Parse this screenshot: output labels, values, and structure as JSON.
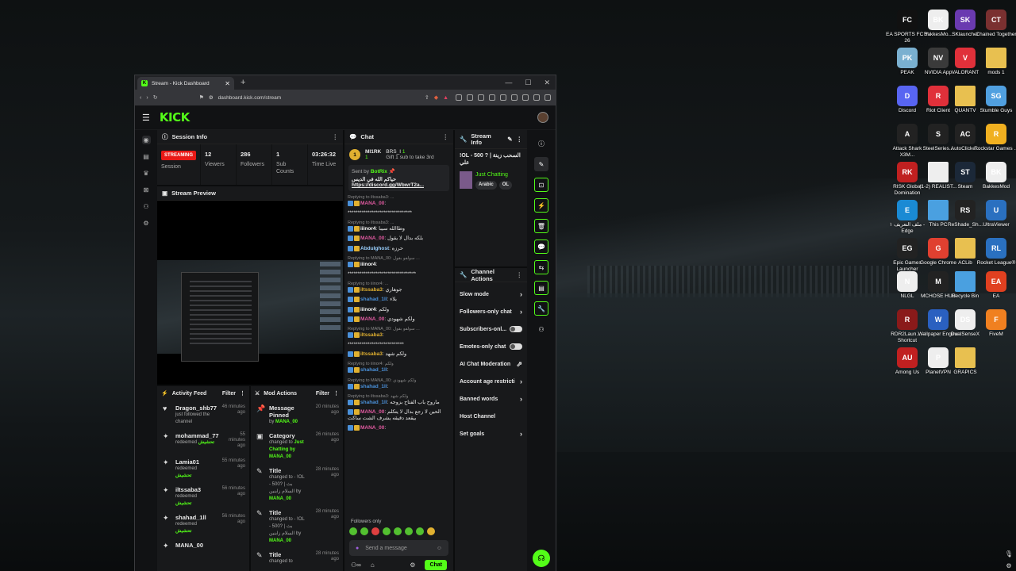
{
  "desktop": {
    "icons": [
      {
        "label": "EA SPORTS FC™ 26",
        "color": "#111",
        "glyph": "FC"
      },
      {
        "label": "BakkesMo...",
        "color": "#eee",
        "glyph": "BK"
      },
      {
        "label": "SKlauncher",
        "color": "#6a3ab0",
        "glyph": "SK"
      },
      {
        "label": "Chained Together",
        "color": "#7a3030",
        "glyph": "CT"
      },
      {
        "label": "PEAK",
        "color": "#7ab0d0",
        "glyph": "PK"
      },
      {
        "label": "NVIDIA App",
        "color": "#3a3a3a",
        "glyph": "NV"
      },
      {
        "label": "VALORANT",
        "color": "#e0303a",
        "glyph": "V"
      },
      {
        "label": "mods 1",
        "color": "#e8c050",
        "glyph": ""
      },
      {
        "label": "Discord",
        "color": "#5865f2",
        "glyph": "D"
      },
      {
        "label": "Riot Client",
        "color": "#e0303a",
        "glyph": "R"
      },
      {
        "label": "QUANTV",
        "color": "#e8c050",
        "glyph": ""
      },
      {
        "label": "Stumble Guys",
        "color": "#50a0e0",
        "glyph": "SG"
      },
      {
        "label": "Attack Shark X3M...",
        "color": "#222",
        "glyph": "A"
      },
      {
        "label": "SteelSeries...",
        "color": "#222",
        "glyph": "S"
      },
      {
        "label": "AutoClicke...",
        "color": "#222",
        "glyph": "AC"
      },
      {
        "label": "Rockstar Games ...",
        "color": "#f0b020",
        "glyph": "R"
      },
      {
        "label": "RISK Global Domination",
        "color": "#c02020",
        "glyph": "RK"
      },
      {
        "label": "(1-2) REALIST...",
        "color": "#eee",
        "glyph": ""
      },
      {
        "label": "Steam",
        "color": "#1b2838",
        "glyph": "ST"
      },
      {
        "label": "BakkesMod",
        "color": "#eee",
        "glyph": "BK"
      },
      {
        "label": "ملف التعريف ١ - Edge",
        "color": "#1a8ad4",
        "glyph": "E"
      },
      {
        "label": "This PC",
        "color": "#4aa0e0",
        "glyph": ""
      },
      {
        "label": "ReShade_Sh...",
        "color": "#222",
        "glyph": "RS"
      },
      {
        "label": "UltraViewer",
        "color": "#2a70c0",
        "glyph": "U"
      },
      {
        "label": "Epic Games Launcher",
        "color": "#222",
        "glyph": "EG"
      },
      {
        "label": "Google Chrome",
        "color": "#e04030",
        "glyph": "G"
      },
      {
        "label": "ACLib",
        "color": "#e8c050",
        "glyph": ""
      },
      {
        "label": "Rocket League®",
        "color": "#2a70c0",
        "glyph": "RL"
      },
      {
        "label": "NLGL",
        "color": "#eee",
        "glyph": "N"
      },
      {
        "label": "MCHOSE HUB",
        "color": "#222",
        "glyph": "M"
      },
      {
        "label": "Recycle Bin",
        "color": "#4aa0e0",
        "glyph": ""
      },
      {
        "label": "EA",
        "color": "#e04020",
        "glyph": "EA"
      },
      {
        "label": "RDR2Laun... - Shortcut",
        "color": "#8a1a1a",
        "glyph": "R"
      },
      {
        "label": "Wallpaper Engine",
        "color": "#2a60c0",
        "glyph": "W"
      },
      {
        "label": "DualSenseX",
        "color": "#eee",
        "glyph": "DS"
      },
      {
        "label": "FiveM",
        "color": "#f08020",
        "glyph": "F"
      },
      {
        "label": "Among Us",
        "color": "#c02020",
        "glyph": "AU"
      },
      {
        "label": "PlanetVPN",
        "color": "#eee",
        "glyph": "P"
      },
      {
        "label": "GRAPICS",
        "color": "#e8c050",
        "glyph": ""
      }
    ]
  },
  "browser": {
    "tab_title": "Stream - Kick Dashboard",
    "url": "dashboard.kick.com/stream"
  },
  "kick": {
    "logo": "KICK",
    "session": {
      "title": "Session Info",
      "status": "STREAMING",
      "status_label": "Session",
      "stats": [
        {
          "value": "12",
          "label": "Viewers"
        },
        {
          "value": "286",
          "label": "Followers"
        },
        {
          "value": "1",
          "label": "Sub Counts"
        },
        {
          "value": "03:26:32",
          "label": "Time Live"
        }
      ]
    },
    "preview": {
      "title": "Stream Preview"
    },
    "activity": {
      "title": "Activity Feed",
      "filter": "Filter",
      "items": [
        {
          "name": "Dragon_shb77",
          "sub": "just followed the channel",
          "extra": "",
          "time": "46 minutes ago",
          "icon": "♥"
        },
        {
          "name": "mohammad_77",
          "sub": "redeemed",
          "extra": "تحشيش",
          "time": "55 minutes ago",
          "icon": "✦"
        },
        {
          "name": "Lamia01",
          "sub": "redeemed",
          "extra": "تحشيش",
          "time": "55 minutes ago",
          "icon": "✦"
        },
        {
          "name": "iltssaba3",
          "sub": "redeemed",
          "extra": "تحشيش",
          "time": "56 minutes ago",
          "icon": "✦"
        },
        {
          "name": "shahad_1ll",
          "sub": "redeemed",
          "extra": "تحشيش",
          "time": "56 minutes ago",
          "icon": "✦"
        },
        {
          "name": "MANA_00",
          "sub": "",
          "extra": "",
          "time": "",
          "icon": "✦"
        }
      ]
    },
    "mod": {
      "title": "Mod Actions",
      "filter": "Filter",
      "items": [
        {
          "name": "Message Pinned",
          "sub": "by",
          "extra": "MANA_00",
          "time": "20 minutes ago",
          "icon": "📌"
        },
        {
          "name": "Category",
          "sub": "changed to",
          "extra": "Just Chatting by MANA_00",
          "time": "26 minutes ago",
          "icon": "▣"
        },
        {
          "name": "Title",
          "sub": "changed to - !OL - 500? | بث السلام زاينين by",
          "extra": "MANA_00",
          "time": "28 minutes ago",
          "icon": "✎"
        },
        {
          "name": "Title",
          "sub": "changed to - !OL - 500? | بث السلام زاينين by",
          "extra": "MANA_00",
          "time": "28 minutes ago",
          "icon": "✎"
        },
        {
          "name": "Title",
          "sub": "changed to",
          "extra": "",
          "time": "28 minutes ago",
          "icon": "✎"
        }
      ]
    },
    "chat": {
      "title": "Chat",
      "gifter": "MI1RK",
      "gifter_count": "1",
      "gift_user": "BRS_I",
      "gift_count": "1",
      "gift_text": "Gift 1 sub to take 3rd",
      "pin_by": "Sent by",
      "pin_bot": "BotRix",
      "pin_text": "حياكم الله في الديس",
      "pin_link": "https://discord.gg/WbwrT2a...",
      "messages": [
        {
          "reply": "Replying to iltssaba3: ...",
          "user": "MANA_00",
          "color": "#e05aa0",
          "text": ":"
        },
        {
          "reply": "",
          "user": "",
          "color": "#fff",
          "text": "********************************"
        },
        {
          "reply": "Replying to iltssaba3: ...",
          "user": "iiinor4",
          "color": "#fff",
          "text": ": وطاالله سيبا"
        },
        {
          "reply": "",
          "user": "MANA_00",
          "color": "#e05aa0",
          "text": ": بلكه بدال لا يقول"
        },
        {
          "reply": "",
          "user": "Abdulghost",
          "color": "#9ad0ff",
          "text": ": حرزه"
        },
        {
          "reply": "Replying to MANA_00: سولفو بقول ...",
          "user": "iiinor4",
          "color": "#fff",
          "text": ":"
        },
        {
          "reply": "",
          "user": "",
          "color": "#fff",
          "text": "**********************************"
        },
        {
          "reply": "Replying to iiinor4: ...",
          "user": "iltssaba3",
          "color": "#e0b030",
          "text": ": جوهاري"
        },
        {
          "reply": "",
          "user": "shahad_1ll",
          "color": "#4a90d9",
          "text": ": بلاء"
        },
        {
          "reply": "",
          "user": "iiinor4",
          "color": "#fff",
          "text": ": ولكم"
        },
        {
          "reply": "",
          "user": "MANA_00",
          "color": "#e05aa0",
          "text": ": ولكم شهودي"
        },
        {
          "reply": "Replying to MANA_00: سولفو بقول ...",
          "user": "iltssaba3",
          "color": "#e0b030",
          "text": ":"
        },
        {
          "reply": "",
          "user": "",
          "color": "#fff",
          "text": "****************************"
        },
        {
          "reply": "",
          "user": "iltssaba3",
          "color": "#e0b030",
          "text": ": ولكم شهد"
        },
        {
          "reply": "Replying to iiinor4: ولكم",
          "user": "shahad_1ll",
          "color": "#4a90d9",
          "text": ":"
        },
        {
          "reply": "Replying to MANA_00: ولكم شهودي",
          "user": "shahad_1ll",
          "color": "#4a90d9",
          "text": ":"
        },
        {
          "reply": "Replying to iltssaba3: ولكم شهد",
          "user": "shahad_1ll",
          "color": "#4a90d9",
          "text": ": ماروح باب الفتاح بزوجه"
        },
        {
          "reply": "",
          "user": "MANA_00",
          "color": "#e05aa0",
          "text": ": الحين لا رجع بدال لا يتكلم بيقعد دقيقه يشرف الشت ساكت"
        },
        {
          "reply": "",
          "user": "MANA_00",
          "color": "#e05aa0",
          "text": ":"
        }
      ],
      "followers_only": "Followers only",
      "placeholder": "Send a message",
      "send_label": "Chat"
    },
    "stream_info": {
      "title": "Stream Info",
      "stream_title": "!OL - 500 ? | السحب زينة علي",
      "category": "Just Chatting",
      "tags": [
        "Arabic",
        "OL"
      ]
    },
    "channel_actions": {
      "title": "Channel Actions",
      "items": [
        {
          "label": "Slow mode",
          "kind": "arrow"
        },
        {
          "label": "Followers-only chat",
          "kind": "arrow"
        },
        {
          "label": "Subscribers-onl...",
          "kind": "toggle"
        },
        {
          "label": "Emotes-only chat",
          "kind": "toggle"
        },
        {
          "label": "AI Chat Moderation",
          "kind": "chart"
        },
        {
          "label": "Account age restricti",
          "kind": "arrow"
        },
        {
          "label": "Banned words",
          "kind": "arrow"
        },
        {
          "label": "Host Channel",
          "kind": "none"
        },
        {
          "label": "Set goals",
          "kind": "arrow"
        }
      ]
    }
  }
}
